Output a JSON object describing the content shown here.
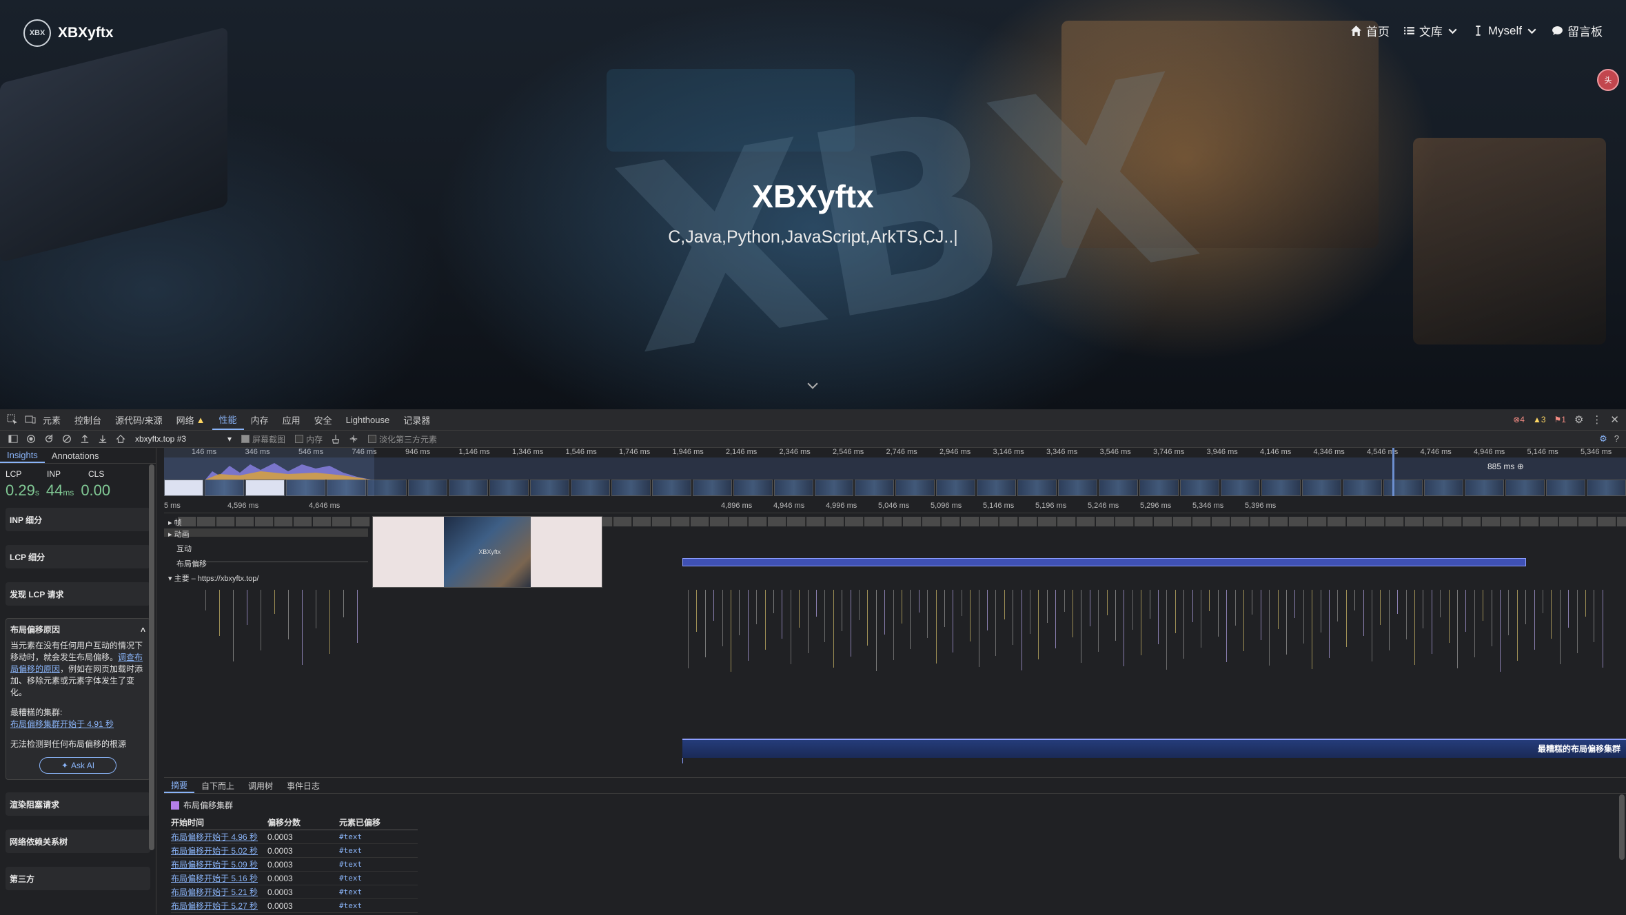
{
  "site": {
    "brand_logo_text": "XBX",
    "brand_name": "XBXyftx",
    "nav": [
      {
        "label": "首页",
        "icon": "home-icon"
      },
      {
        "label": "文库",
        "icon": "list-icon"
      },
      {
        "label": "Myself",
        "icon": "cursor-icon"
      },
      {
        "label": "留言板",
        "icon": "chat-icon"
      }
    ],
    "hero_title": "XBXyftx",
    "hero_subtitle": "C,Java,Python,JavaScript,ArkTS,CJ..|",
    "background_letters": "XBX",
    "float_avatar_text": "头"
  },
  "devtools": {
    "tabs": [
      "元素",
      "控制台",
      "源代码/来源",
      "网络",
      "性能",
      "内存",
      "应用",
      "安全",
      "Lighthouse",
      "记录器"
    ],
    "active_tab": "性能",
    "errors": "4",
    "warnings": "3",
    "issues": "1",
    "toolbar": {
      "recording_select": "xbxyftx.top #3",
      "screenshots_label": "屏幕截图",
      "memory_label": "内存",
      "dim_third_party_label": "淡化第三方元素"
    },
    "sidebar": {
      "tabs": [
        "Insights",
        "Annotations"
      ],
      "metrics": {
        "lcp_label": "LCP",
        "inp_label": "INP",
        "cls_label": "CLS",
        "lcp_value": "0.29",
        "lcp_unit": "s",
        "inp_value": "44",
        "inp_unit": "ms",
        "cls_value": "0.00"
      },
      "cards_top": [
        "INP 细分",
        "LCP 细分",
        "发现 LCP 请求"
      ],
      "expanded": {
        "title": "布局偏移原因",
        "body_1": "当元素在没有任何用户互动的情况下移动时，就会发生布局偏移。",
        "body_link": "调查布局偏移的原因",
        "body_2": "，例如在网页加载时添加、移除元素或元素字体发生了变化。",
        "worst_label": "最糟糕的集群:",
        "worst_link": "布局偏移集群开始于 4.91 秒",
        "no_root": "无法检测到任何布局偏移的根源",
        "ask_ai": "Ask AI"
      },
      "cards_bottom": [
        "渲染阻塞请求",
        "网络依赖关系树",
        "第三方"
      ]
    },
    "overview_ticks": [
      "146 ms",
      "346 ms",
      "546 ms",
      "746 ms",
      "946 ms",
      "1,146 ms",
      "1,346 ms",
      "1,546 ms",
      "1,746 ms",
      "1,946 ms",
      "2,146 ms",
      "2,346 ms",
      "2,546 ms",
      "2,746 ms",
      "2,946 ms",
      "3,146 ms",
      "3,346 ms",
      "3,546 ms",
      "3,746 ms",
      "3,946 ms",
      "4,146 ms",
      "4,346 ms",
      "4,546 ms",
      "4,746 ms",
      "4,946 ms",
      "5,146 ms",
      "5,346 ms"
    ],
    "overview_zoom": "885 ms",
    "main_ticks": [
      "5 ms",
      "4,596 ms",
      "4,646 ms",
      "4,896 ms",
      "4,946 ms",
      "4,996 ms",
      "5,046 ms",
      "5,096 ms",
      "5,146 ms",
      "5,196 ms",
      "5,246 ms",
      "5,296 ms",
      "5,346 ms",
      "5,396 ms"
    ],
    "tracks": {
      "frames": "帧",
      "animations": "动画",
      "interactions": "互动",
      "layout_shifts": "布局偏移",
      "main": "主要 – https://xbxyftx.top/"
    },
    "preview_watermark": "XBXyftx",
    "worst_cluster_label": "最糟糕的布局偏移集群",
    "bottom": {
      "tabs": [
        "摘要",
        "自下而上",
        "调用树",
        "事件日志"
      ],
      "cluster_title": "布局偏移集群",
      "columns": [
        "开始时间",
        "偏移分数",
        "元素已偏移"
      ],
      "rows": [
        [
          "布局偏移开始于 4.96 秒",
          "0.0003",
          "#text"
        ],
        [
          "布局偏移开始于 5.02 秒",
          "0.0003",
          "#text"
        ],
        [
          "布局偏移开始于 5.09 秒",
          "0.0003",
          "#text"
        ],
        [
          "布局偏移开始于 5.16 秒",
          "0.0003",
          "#text"
        ],
        [
          "布局偏移开始于 5.21 秒",
          "0.0003",
          "#text"
        ],
        [
          "布局偏移开始于 5.27 秒",
          "0.0003",
          "#text"
        ]
      ]
    },
    "colors": {
      "accent": "#8ab4f8",
      "good_metric": "#81c995",
      "layout_shift": "#3f51b5",
      "cluster_swatch": "#b47eea"
    }
  }
}
